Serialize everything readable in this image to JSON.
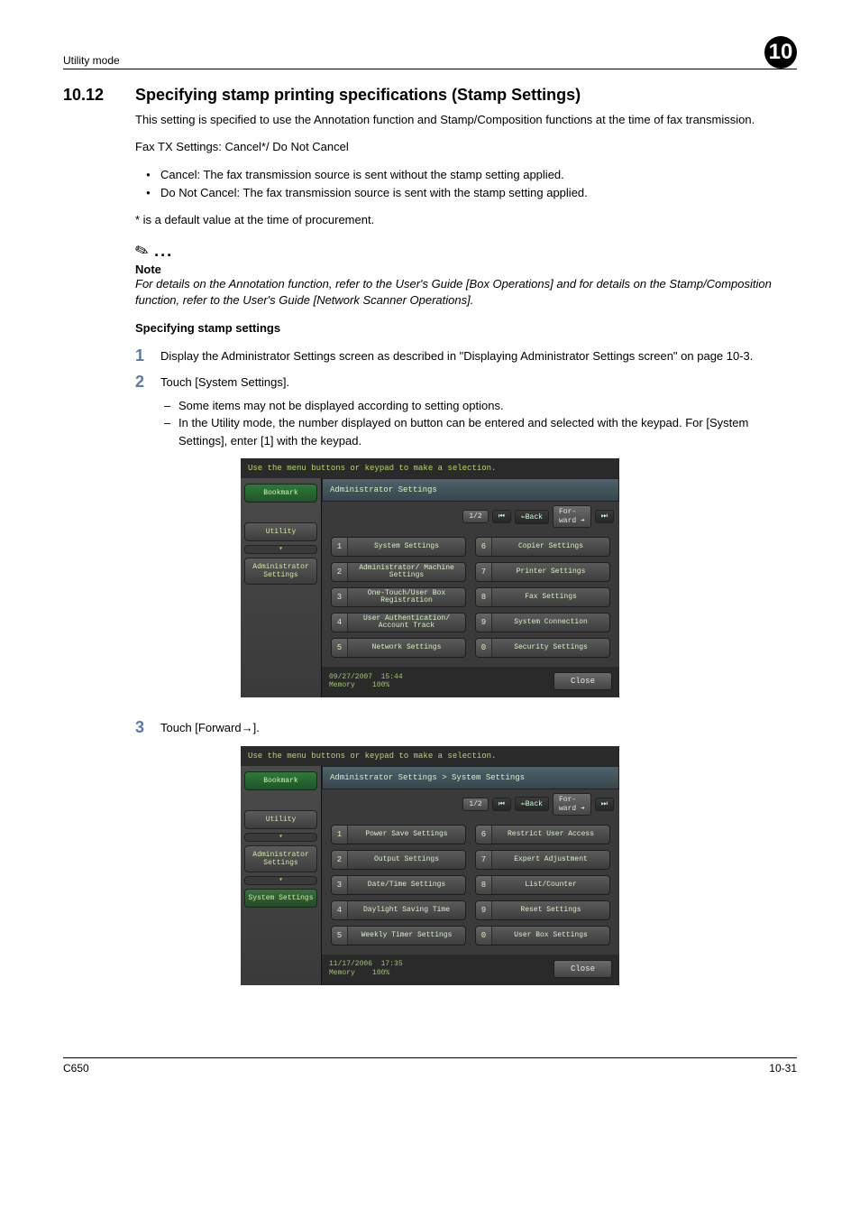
{
  "header": {
    "left": "Utility mode",
    "right": "10"
  },
  "section": {
    "number": "10.12",
    "title": "Specifying stamp printing specifications (Stamp Settings)"
  },
  "intro": "This setting is specified to use the Annotation function and Stamp/Composition functions at the time of fax transmission.",
  "fax_line": "Fax TX Settings: Cancel*/ Do Not Cancel",
  "bullets": [
    "Cancel: The fax transmission source is sent without the stamp setting applied.",
    "Do Not Cancel: The fax transmission source is sent with the stamp setting applied."
  ],
  "default_note": "* is a default value at the time of procurement.",
  "note": {
    "label": "Note",
    "text": "For details on the Annotation function, refer to the User's Guide [Box Operations] and for details on the Stamp/Composition function, refer to the User's Guide [Network Scanner Operations]."
  },
  "subhead": "Specifying stamp settings",
  "steps": [
    {
      "n": "1",
      "text": "Display the Administrator Settings screen as described in \"Displaying Administrator Settings screen\" on page 10-3."
    },
    {
      "n": "2",
      "text": "Touch [System Settings].",
      "subs": [
        "Some items may not be displayed according to setting options.",
        "In the Utility mode, the number displayed on button can be entered and selected with the keypad. For [System Settings], enter [1] with the keypad."
      ]
    },
    {
      "n": "3",
      "text": "Touch [Forward→]."
    }
  ],
  "device_common": {
    "instruction": "Use the menu buttons or keypad to make a selection.",
    "bookmark": "Bookmark",
    "utility": "Utility",
    "admin": "Administrator Settings",
    "system": "System Settings",
    "page": "1/2",
    "back": "⇐Back",
    "fwd": "For-\nward",
    "close": "Close"
  },
  "device1": {
    "title": "Administrator Settings",
    "menu": [
      {
        "n": "1",
        "l": "System Settings"
      },
      {
        "n": "6",
        "l": "Copier Settings"
      },
      {
        "n": "2",
        "l": "Administrator/\nMachine Settings"
      },
      {
        "n": "7",
        "l": "Printer Settings"
      },
      {
        "n": "3",
        "l": "One-Touch/User Box\nRegistration"
      },
      {
        "n": "8",
        "l": "Fax Settings"
      },
      {
        "n": "4",
        "l": "User Authentication/\nAccount Track"
      },
      {
        "n": "9",
        "l": "System Connection"
      },
      {
        "n": "5",
        "l": "Network Settings"
      },
      {
        "n": "0",
        "l": "Security Settings"
      }
    ],
    "footer": {
      "date": "09/27/2007",
      "time": "15:44",
      "mem": "Memory",
      "pct": "100%"
    }
  },
  "device2": {
    "title": "Administrator Settings > System Settings",
    "menu": [
      {
        "n": "1",
        "l": "Power Save Settings"
      },
      {
        "n": "6",
        "l": "Restrict User Access"
      },
      {
        "n": "2",
        "l": "Output Settings"
      },
      {
        "n": "7",
        "l": "Expert Adjustment"
      },
      {
        "n": "3",
        "l": "Date/Time Settings"
      },
      {
        "n": "8",
        "l": "List/Counter"
      },
      {
        "n": "4",
        "l": "Daylight Saving Time"
      },
      {
        "n": "9",
        "l": "Reset Settings"
      },
      {
        "n": "5",
        "l": "Weekly Timer Settings"
      },
      {
        "n": "0",
        "l": "User Box Settings"
      }
    ],
    "footer": {
      "date": "11/17/2006",
      "time": "17:35",
      "mem": "Memory",
      "pct": "100%"
    }
  },
  "footer": {
    "left": "C650",
    "right": "10-31"
  }
}
